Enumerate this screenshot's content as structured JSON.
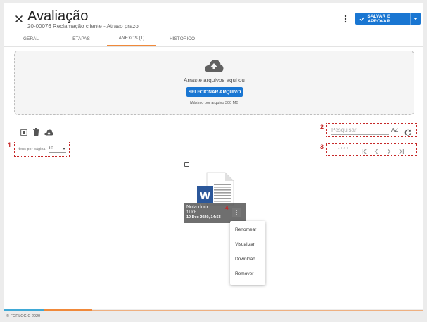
{
  "header": {
    "title": "Avaliação",
    "subtitle": "20-00076 Reclamação cliente - Atraso prazo",
    "close_icon": "close-icon",
    "more_icon": "kebab-vertical-icon",
    "save_button": {
      "label": "SALVAR E APROVAR",
      "icon": "check-icon",
      "dropdown_icon": "caret-down-icon"
    },
    "accent_color": "#1976d2"
  },
  "tabs": [
    {
      "label": "GERAL",
      "active": false
    },
    {
      "label": "ETAPAS",
      "active": false
    },
    {
      "label": "ANEXOS (1)",
      "active": true
    },
    {
      "label": "HISTÓRICO",
      "active": false
    }
  ],
  "upload": {
    "icon": "cloud-upload-icon",
    "drop_text": "Arraste arquivos aqui ou",
    "select_button": "SELECIONAR ARQUIVO",
    "max_text": "Máximo por arquivo 300 MB"
  },
  "toolbar": {
    "icons": [
      "select-all-icon",
      "trash-icon",
      "cloud-download-icon"
    ]
  },
  "pagination": {
    "items_per_page_label": "Itens por página:",
    "items_per_page_value": "10",
    "range_label": "1 - 1 / 1",
    "icons": [
      "first-page-icon",
      "prev-page-icon",
      "next-page-icon",
      "last-page-icon"
    ]
  },
  "search": {
    "placeholder": "Pesquisar",
    "sort_label": "AZ",
    "refresh_icon": "refresh-icon"
  },
  "markers": [
    "1",
    "2",
    "3",
    "4"
  ],
  "file": {
    "name": "Nota.docx",
    "size": "11 Kb",
    "date": "10 Dec 2020, 14:53",
    "icon": "word-document-icon"
  },
  "file_menu": [
    "Renomear",
    "Visualizar",
    "Download",
    "Remover"
  ],
  "footer": {
    "copyright": "© FORLOGIC 2020",
    "colors": [
      "#3fa9d6",
      "#f0893a"
    ]
  }
}
